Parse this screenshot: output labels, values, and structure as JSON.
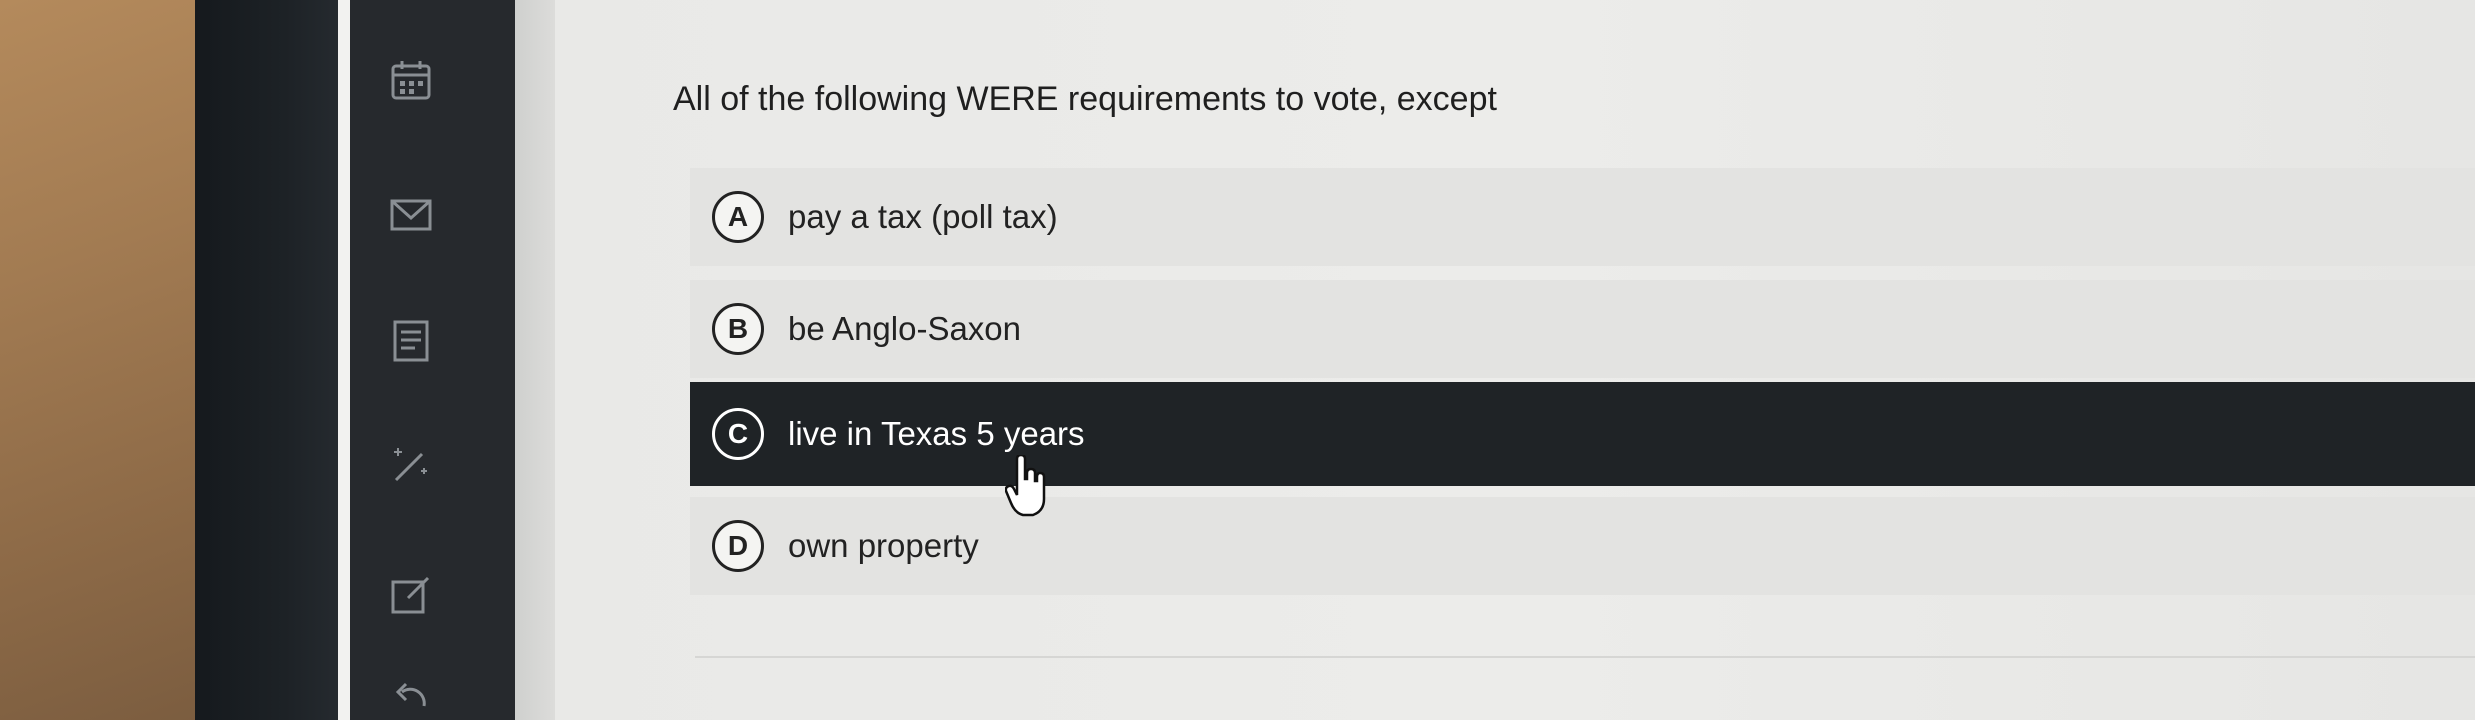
{
  "question": {
    "text": "All of the following WERE requirements to vote, except"
  },
  "options": [
    {
      "letter": "A",
      "text": "pay a tax (poll tax)",
      "selected": false
    },
    {
      "letter": "B",
      "text": "be Anglo-Saxon",
      "selected": false
    },
    {
      "letter": "C",
      "text": "live in Texas 5 years",
      "selected": true
    },
    {
      "letter": "D",
      "text": "own property",
      "selected": false
    }
  ],
  "rail_icons": [
    "calendar-icon",
    "mail-icon",
    "document-list-icon",
    "magic-wand-icon",
    "edit-icon",
    "back-arrow-icon"
  ],
  "colors": {
    "selected_background": "#1f2326",
    "rail_background": "#26292d",
    "page_background": "#ececea"
  }
}
